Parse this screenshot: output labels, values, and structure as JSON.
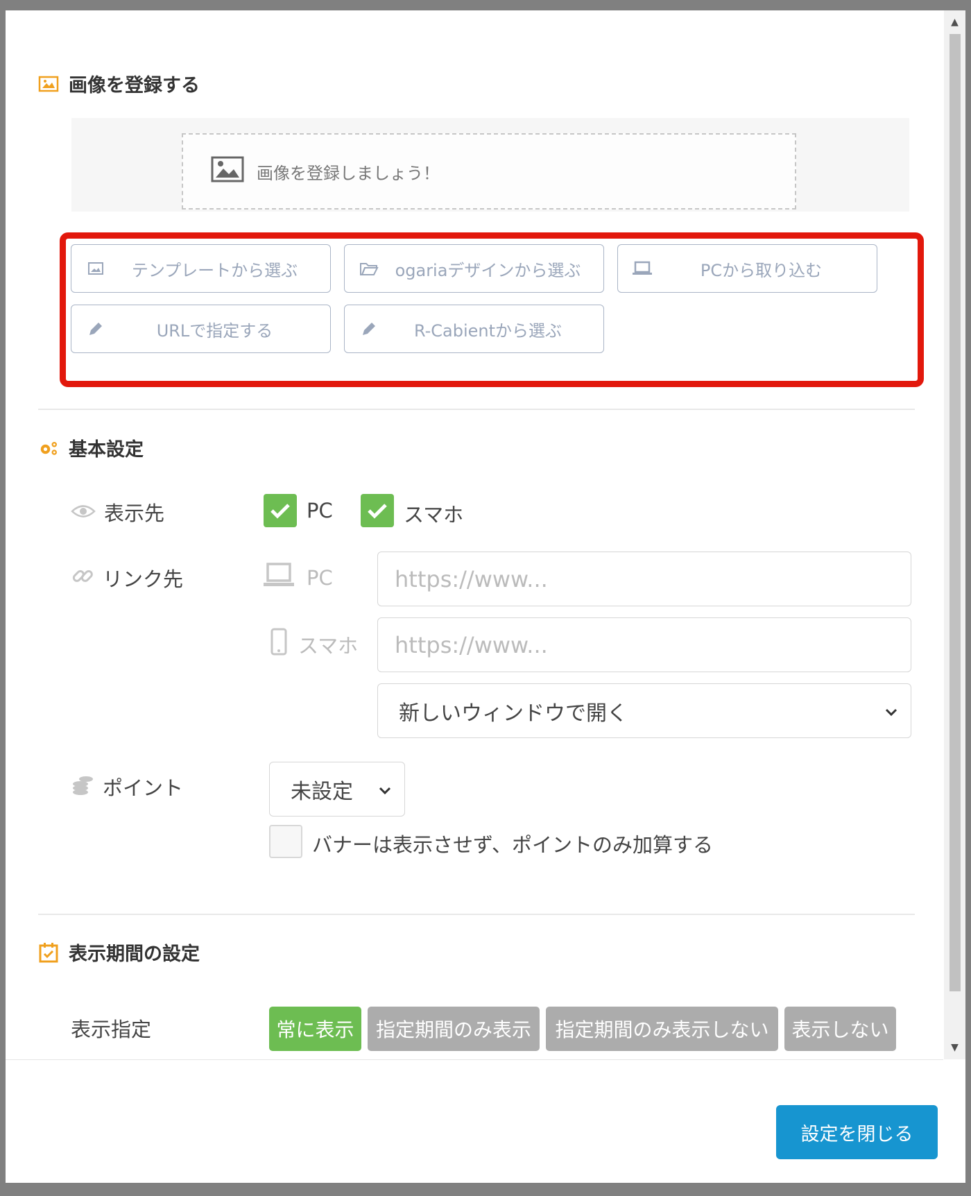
{
  "modal": {
    "image_section": {
      "title": "画像を登録する",
      "dropzone_text": "画像を登録しましょう！",
      "source_buttons": [
        {
          "label": "テンプレートから選ぶ",
          "icon": "image-icon"
        },
        {
          "label": "ogariaデザインから選ぶ",
          "icon": "folder-open-icon"
        },
        {
          "label": "PCから取り込む",
          "icon": "laptop-icon"
        },
        {
          "label": "URLで指定する",
          "icon": "pencil-icon"
        },
        {
          "label": "R-Cabientから選ぶ",
          "icon": "pencil-icon"
        }
      ]
    },
    "basic_section": {
      "title": "基本設定",
      "display_target": {
        "label": "表示先",
        "options": [
          {
            "label": "PC",
            "checked": true
          },
          {
            "label": "スマホ",
            "checked": true
          }
        ]
      },
      "link": {
        "label": "リンク先",
        "pc_label": "PC",
        "sp_label": "スマホ",
        "pc_placeholder": "https://www...",
        "sp_placeholder": "https://www...",
        "window_select": "新しいウィンドウで開く"
      },
      "point": {
        "label": "ポイント",
        "select_value": "未設定",
        "checkbox_label": "バナーは表示させず、ポイントのみ加算する",
        "checked": false
      }
    },
    "period_section": {
      "title": "表示期間の設定",
      "label": "表示指定",
      "options": [
        {
          "label": "常に表示",
          "active": true
        },
        {
          "label": "指定期間のみ表示",
          "active": false
        },
        {
          "label": "指定期間のみ表示しない",
          "active": false
        },
        {
          "label": "表示しない",
          "active": false
        }
      ]
    },
    "footer": {
      "close_button": "設定を閉じる"
    }
  },
  "colors": {
    "accent_orange": "#f0a01e",
    "check_green": "#6dbd52",
    "primary_blue": "#1795d0",
    "highlight_red": "#e2180c",
    "inactive_gray": "#acacac"
  }
}
